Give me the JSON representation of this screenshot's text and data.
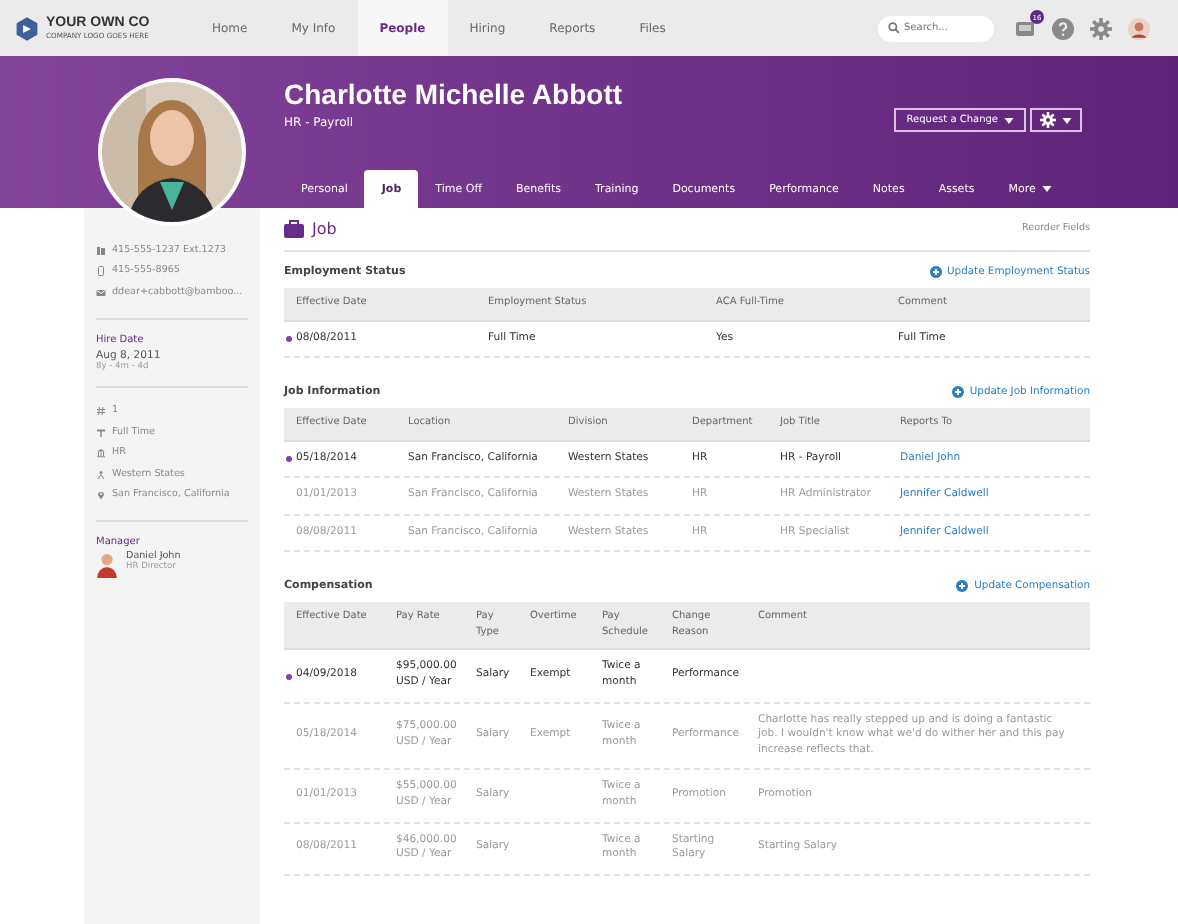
{
  "topbar": {
    "logo": {
      "name": "YOUR OWN CO",
      "tagline": "COMPANY LOGO GOES HERE"
    },
    "nav": [
      {
        "label": "Home",
        "selected": false
      },
      {
        "label": "My Info",
        "selected": false
      },
      {
        "label": "People",
        "selected": true
      },
      {
        "label": "Hiring",
        "selected": false
      },
      {
        "label": "Reports",
        "selected": false
      },
      {
        "label": "Files",
        "selected": false
      }
    ],
    "search": {
      "placeholder": "Search..."
    },
    "notification_count": "16"
  },
  "profile": {
    "name": "Charlotte Michelle Abbott",
    "subtitle": "HR - Payroll",
    "request_button": "Request a Change",
    "tabs": [
      {
        "label": "Personal",
        "selected": false
      },
      {
        "label": "Job",
        "selected": true
      },
      {
        "label": "Time Off",
        "selected": false
      },
      {
        "label": "Benefits",
        "selected": false
      },
      {
        "label": "Training",
        "selected": false
      },
      {
        "label": "Documents",
        "selected": false
      },
      {
        "label": "Performance",
        "selected": false
      },
      {
        "label": "Notes",
        "selected": false
      },
      {
        "label": "Assets",
        "selected": false
      },
      {
        "label": "More",
        "selected": false
      }
    ]
  },
  "sidebar": {
    "contacts": [
      {
        "kind": "desk-phone",
        "text": "415-555-1237  Ext.1273"
      },
      {
        "kind": "mobile",
        "text": "415-555-8965"
      },
      {
        "kind": "email",
        "text": "ddear+cabbott@bamboo..."
      }
    ],
    "hire_date": {
      "label": "Hire Date",
      "date": "Aug 8, 2011",
      "duration": "8y - 4m - 4d"
    },
    "details": [
      {
        "kind": "number",
        "text": "1"
      },
      {
        "kind": "status",
        "text": "Full Time"
      },
      {
        "kind": "department",
        "text": "HR"
      },
      {
        "kind": "division",
        "text": "Western States"
      },
      {
        "kind": "location",
        "text": "San Francisco, California"
      }
    ],
    "manager": {
      "label": "Manager",
      "name": "Daniel John",
      "title": "HR Director"
    }
  },
  "job": {
    "title": "Job",
    "reorder": "Reorder Fields",
    "sections": [
      {
        "title": "Employment Status",
        "action": "Update Employment Status",
        "columns": [
          {
            "label": "Effective Date",
            "kind": "text"
          },
          {
            "label": "Employment Status",
            "kind": "text"
          },
          {
            "label": "ACA Full-Time",
            "kind": "text"
          },
          {
            "label": "Comment",
            "kind": "text"
          }
        ],
        "rows": [
          {
            "current": true,
            "cells": [
              "08/08/2011",
              "Full Time",
              "Yes",
              "Full Time"
            ]
          }
        ]
      },
      {
        "title": "Job Information",
        "action": "Update Job Information",
        "columns": [
          {
            "label": "Effective Date",
            "kind": "text"
          },
          {
            "label": "Location",
            "kind": "text"
          },
          {
            "label": "Division",
            "kind": "text"
          },
          {
            "label": "Department",
            "kind": "text"
          },
          {
            "label": "Job Title",
            "kind": "text"
          },
          {
            "label": "Reports To",
            "kind": "link"
          }
        ],
        "rows": [
          {
            "current": true,
            "cells": [
              "05/18/2014",
              "San Francisco, California",
              "Western States",
              "HR",
              "HR - Payroll",
              "Daniel John"
            ]
          },
          {
            "current": false,
            "cells": [
              "01/01/2013",
              "San Francisco, California",
              "Western States",
              "HR",
              "HR Administrator",
              "Jennifer Caldwell"
            ]
          },
          {
            "current": false,
            "cells": [
              "08/08/2011",
              "San Francisco, California",
              "Western States",
              "HR",
              "HR Specialist",
              "Jennifer Caldwell"
            ]
          }
        ]
      },
      {
        "title": "Compensation",
        "action": "Update Compensation",
        "columns": [
          {
            "label": "Effective Date",
            "kind": "text"
          },
          {
            "label": "Pay Rate",
            "kind": "text"
          },
          {
            "label": "Pay Type",
            "kind": "text"
          },
          {
            "label": "Overtime",
            "kind": "text"
          },
          {
            "label": "Pay Schedule",
            "kind": "text"
          },
          {
            "label": "Change Reason",
            "kind": "text"
          },
          {
            "label": "Comment",
            "kind": "text"
          }
        ],
        "rows": [
          {
            "current": true,
            "cells": [
              "04/09/2018",
              "$95,000.00 USD / Year",
              "Salary",
              "Exempt",
              "Twice a month",
              "Performance",
              null
            ]
          },
          {
            "current": false,
            "cells": [
              "05/18/2014",
              "$75,000.00 USD / Year",
              "Salary",
              "Exempt",
              "Twice a month",
              "Performance",
              "Charlotte has really stepped up and is doing a fantastic job. I wouldn't know what we'd do wither her and this pay increase reflects that."
            ]
          },
          {
            "current": false,
            "cells": [
              "01/01/2013",
              "$55,000.00 USD / Year",
              "Salary",
              null,
              "Twice a month",
              "Promotion",
              "Promotion"
            ]
          },
          {
            "current": false,
            "cells": [
              "08/08/2011",
              "$46,000.00 USD / Year",
              "Salary",
              null,
              "Twice a month",
              "Starting Salary",
              "Starting Salary"
            ]
          }
        ]
      }
    ]
  }
}
